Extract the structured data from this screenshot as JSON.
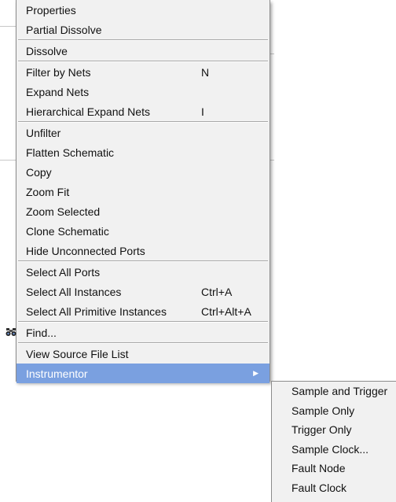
{
  "context_menu": {
    "groups": [
      [
        {
          "label": "Properties",
          "shortcut": ""
        },
        {
          "label": "Partial Dissolve",
          "shortcut": ""
        }
      ],
      [
        {
          "label": "Dissolve",
          "shortcut": ""
        }
      ],
      [
        {
          "label": "Filter by Nets",
          "shortcut": "N"
        },
        {
          "label": "Expand Nets",
          "shortcut": ""
        },
        {
          "label": "Hierarchical Expand Nets",
          "shortcut": "I"
        }
      ],
      [
        {
          "label": "Unfilter",
          "shortcut": ""
        },
        {
          "label": "Flatten Schematic",
          "shortcut": ""
        },
        {
          "label": "Copy",
          "shortcut": ""
        },
        {
          "label": "Zoom Fit",
          "shortcut": ""
        },
        {
          "label": "Zoom Selected",
          "shortcut": ""
        },
        {
          "label": "Clone Schematic",
          "shortcut": ""
        },
        {
          "label": "Hide Unconnected Ports",
          "shortcut": ""
        }
      ],
      [
        {
          "label": "Select All Ports",
          "shortcut": ""
        },
        {
          "label": "Select All Instances",
          "shortcut": "Ctrl+A"
        },
        {
          "label": "Select All Primitive Instances",
          "shortcut": "Ctrl+Alt+A"
        }
      ],
      [
        {
          "label": "Find...",
          "shortcut": "",
          "icon": "binoculars-icon"
        }
      ],
      [
        {
          "label": "View Source File List",
          "shortcut": ""
        },
        {
          "label": "Instrumentor",
          "shortcut": "",
          "submenu": true,
          "highlighted": true
        }
      ]
    ]
  },
  "submenu": {
    "items": [
      {
        "label": "Sample and Trigger"
      },
      {
        "label": "Sample Only"
      },
      {
        "label": "Trigger Only"
      },
      {
        "label": "Sample Clock..."
      },
      {
        "label": "Fault Node"
      },
      {
        "label": "Fault Clock"
      }
    ]
  },
  "colors": {
    "menu_bg": "#f1f1f1",
    "highlight": "#7aa0e0",
    "border": "#8c8c8c"
  }
}
